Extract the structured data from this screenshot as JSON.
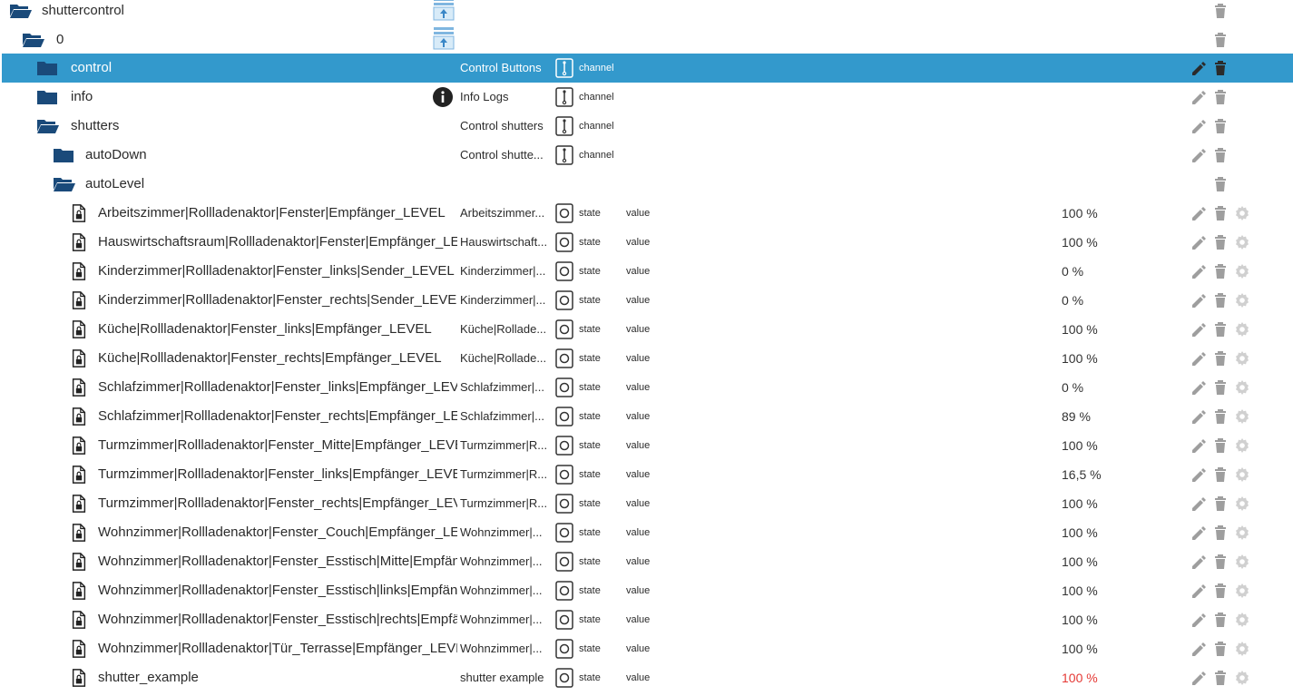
{
  "colors": {
    "selected_bg": "#3399cc",
    "folder": "#1a4a7a",
    "muted_icon": "#9e9e9e",
    "warn_value": "#e53935"
  },
  "tree": {
    "root": {
      "name": "shuttercontrol"
    },
    "instance": {
      "name": "0"
    },
    "control": {
      "name": "control",
      "desc": "Control Buttons",
      "type": "channel"
    },
    "info": {
      "name": "info",
      "desc": "Info Logs",
      "type": "channel"
    },
    "shutters": {
      "name": "shutters",
      "desc": "Control shutters",
      "type": "channel"
    },
    "autoDown": {
      "name": "autoDown",
      "desc": "Control shutte...",
      "type": "channel"
    },
    "autoLevel": {
      "name": "autoLevel"
    },
    "states": [
      {
        "name": "Arbeitszimmer|Rollladenaktor|Fenster|Empfänger_LEVEL",
        "desc": "Arbeitszimmer...",
        "type": "state",
        "role": "value",
        "value": "100 %"
      },
      {
        "name": "Hauswirtschaftsraum|Rollladenaktor|Fenster|Empfänger_LEVEL",
        "desc": "Hauswirtschaft...",
        "type": "state",
        "role": "value",
        "value": "100 %"
      },
      {
        "name": "Kinderzimmer|Rollladenaktor|Fenster_links|Sender_LEVEL",
        "desc": "Kinderzimmer|...",
        "type": "state",
        "role": "value",
        "value": "0 %"
      },
      {
        "name": "Kinderzimmer|Rollladenaktor|Fenster_rechts|Sender_LEVEL",
        "desc": "Kinderzimmer|...",
        "type": "state",
        "role": "value",
        "value": "0 %"
      },
      {
        "name": "Küche|Rollladenaktor|Fenster_links|Empfänger_LEVEL",
        "desc": "Küche|Rollade...",
        "type": "state",
        "role": "value",
        "value": "100 %"
      },
      {
        "name": "Küche|Rollladenaktor|Fenster_rechts|Empfänger_LEVEL",
        "desc": "Küche|Rollade...",
        "type": "state",
        "role": "value",
        "value": "100 %"
      },
      {
        "name": "Schlafzimmer|Rollladenaktor|Fenster_links|Empfänger_LEVEL",
        "desc": "Schlafzimmer|...",
        "type": "state",
        "role": "value",
        "value": "0 %"
      },
      {
        "name": "Schlafzimmer|Rollladenaktor|Fenster_rechts|Empfänger_LEVEL",
        "desc": "Schlafzimmer|...",
        "type": "state",
        "role": "value",
        "value": "89 %"
      },
      {
        "name": "Turmzimmer|Rollladenaktor|Fenster_Mitte|Empfänger_LEVEL",
        "desc": "Turmzimmer|R...",
        "type": "state",
        "role": "value",
        "value": "100 %"
      },
      {
        "name": "Turmzimmer|Rollladenaktor|Fenster_links|Empfänger_LEVEL",
        "desc": "Turmzimmer|R...",
        "type": "state",
        "role": "value",
        "value": "16,5 %"
      },
      {
        "name": "Turmzimmer|Rollladenaktor|Fenster_rechts|Empfänger_LEVEL",
        "desc": "Turmzimmer|R...",
        "type": "state",
        "role": "value",
        "value": "100 %"
      },
      {
        "name": "Wohnzimmer|Rollladenaktor|Fenster_Couch|Empfänger_LEVEL",
        "desc": "Wohnzimmer|...",
        "type": "state",
        "role": "value",
        "value": "100 %"
      },
      {
        "name": "Wohnzimmer|Rollladenaktor|Fenster_Esstisch|Mitte|Empfänger_LEVEL",
        "desc": "Wohnzimmer|...",
        "type": "state",
        "role": "value",
        "value": "100 %"
      },
      {
        "name": "Wohnzimmer|Rollladenaktor|Fenster_Esstisch|links|Empfänger_LEVEL",
        "desc": "Wohnzimmer|...",
        "type": "state",
        "role": "value",
        "value": "100 %"
      },
      {
        "name": "Wohnzimmer|Rollladenaktor|Fenster_Esstisch|rechts|Empfänger_LEVEL",
        "desc": "Wohnzimmer|...",
        "type": "state",
        "role": "value",
        "value": "100 %"
      },
      {
        "name": "Wohnzimmer|Rollladenaktor|Tür_Terrasse|Empfänger_LEVEL",
        "desc": "Wohnzimmer|...",
        "type": "state",
        "role": "value",
        "value": "100 %"
      },
      {
        "name": "shutter_example",
        "desc": "shutter example",
        "type": "state",
        "role": "value",
        "value": "100 %",
        "value_color": "warn"
      }
    ]
  },
  "icons": {
    "open_folder": "folder-open-icon",
    "closed_folder": "folder-icon",
    "file": "file-lock-icon",
    "channel": "channel-icon",
    "state": "state-icon",
    "edit": "pencil-icon",
    "delete": "trash-icon",
    "settings": "gear-icon",
    "info": "info-icon",
    "upload": "upload-icon"
  }
}
